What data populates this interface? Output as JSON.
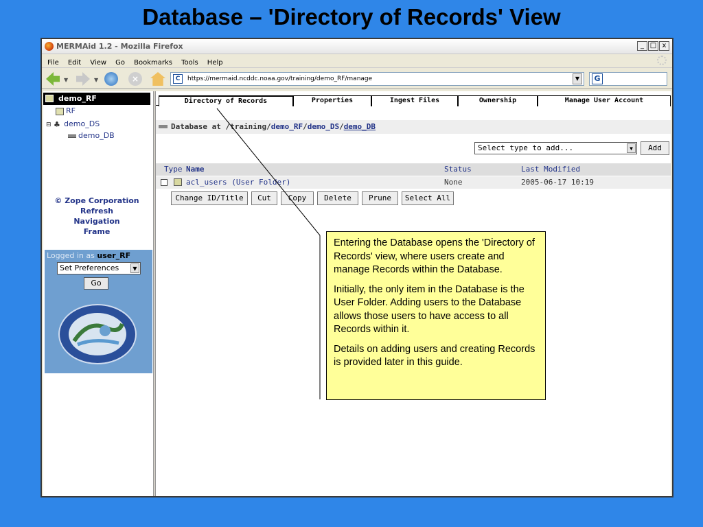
{
  "slide": {
    "title": "Database – 'Directory of Records' View"
  },
  "window": {
    "title": "MERMAid 1.2 - Mozilla Firefox",
    "controls": [
      "_",
      "□",
      "x"
    ]
  },
  "menu": [
    "File",
    "Edit",
    "View",
    "Go",
    "Bookmarks",
    "Tools",
    "Help"
  ],
  "nav": {
    "url": "https://mermaid.ncddc.noaa.gov/training/demo_RF/manage"
  },
  "left": {
    "header": "demo_RF",
    "tree": [
      "RF",
      "demo_DS",
      "demo_DB"
    ],
    "zope_lines": [
      "© Zope Corporation",
      "Refresh",
      "Navigation",
      "Frame"
    ],
    "logged_prefix": "Logged in as",
    "user": "user_RF",
    "prefs_value": "Set Preferences",
    "go_label": "Go"
  },
  "tabs": [
    "Directory of Records",
    "Properties",
    "Ingest Files",
    "Ownership",
    "Manage User Account"
  ],
  "breadcrumb": {
    "prefix": "Database at",
    "path_plain": "/training/",
    "p1": "demo_RF",
    "sep1": "/",
    "p2": "demo_DS",
    "sep2": "/",
    "p3": "demo_DB"
  },
  "add": {
    "select_value": "Select type to add...",
    "button": "Add"
  },
  "table": {
    "headers": {
      "type": "Type",
      "name": "Name",
      "status": "Status",
      "modified": "Last Modified"
    },
    "rows": [
      {
        "name": "acl_users (User Folder)",
        "status": "None",
        "modified": "2005-06-17 10:19"
      }
    ]
  },
  "actions": [
    "Change ID/Title",
    "Cut",
    "Copy",
    "Delete",
    "Prune",
    "Select All"
  ],
  "callout": [
    "Entering the Database opens the 'Directory of Records' view, where users create and manage Records within the Database.",
    "Initially, the only item in the Database is the User Folder.  Adding users to the Database allows those users to have access to all Records within it.",
    "Details on adding users and creating Records is provided later in this guide."
  ]
}
